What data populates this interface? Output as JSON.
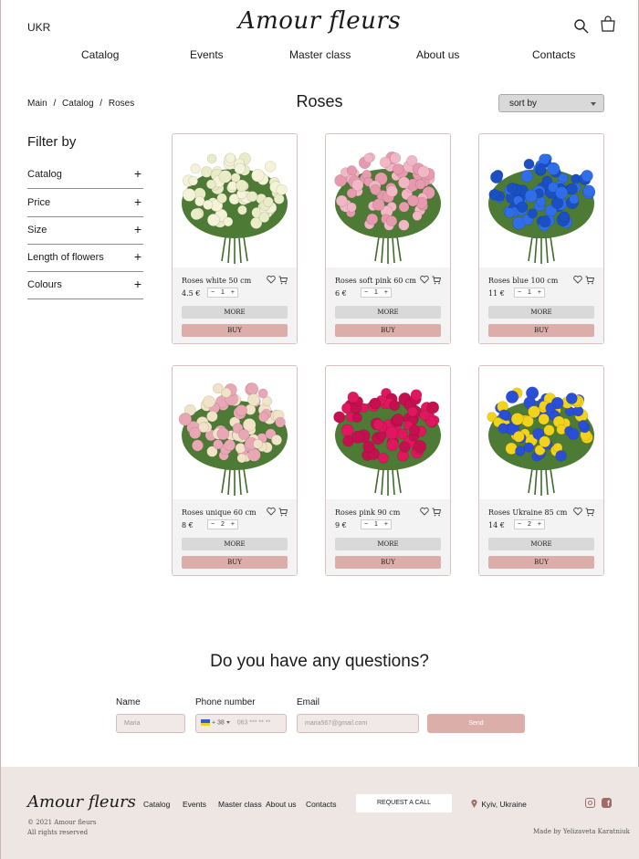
{
  "header": {
    "lang": "UKR",
    "logo": "Amour fleurs",
    "search_icon": "search-icon",
    "cart_icon": "shopping-bag-icon"
  },
  "nav": [
    "Catalog",
    "Events",
    "Master class",
    "About us",
    "Contacts"
  ],
  "breadcrumb": [
    "Main",
    "/",
    "Catalog",
    "/",
    "Roses"
  ],
  "page_title": "Roses",
  "sort": {
    "label": "sort by"
  },
  "filters": {
    "title": "Filter by",
    "items": [
      "Catalog",
      "Price",
      "Size",
      "Length of flowers",
      "Colours"
    ],
    "expand_symbol": "+"
  },
  "products": [
    {
      "name": "Roses white 50 cm",
      "price": "4.5 €",
      "qty": "1",
      "more": "MORE",
      "buy": "BUY",
      "colors": [
        "#f4f3d8",
        "#e9ecc7"
      ]
    },
    {
      "name": "Roses soft pink 60 cm",
      "price": "6 €",
      "qty": "1",
      "more": "MORE",
      "buy": "BUY",
      "colors": [
        "#f2b7c4",
        "#e79aae"
      ]
    },
    {
      "name": "Roses blue 100 cm",
      "price": "11 €",
      "qty": "1",
      "more": "MORE",
      "buy": "BUY",
      "colors": [
        "#2f6ee8",
        "#1b4fc4"
      ]
    },
    {
      "name": "Roses unique 60 cm",
      "price": "8 €",
      "qty": "2",
      "more": "MORE",
      "buy": "BUY",
      "colors": [
        "#f1e3c8",
        "#e9a7b5"
      ]
    },
    {
      "name": "Roses pink 90 cm",
      "price": "9 €",
      "qty": "1",
      "more": "MORE",
      "buy": "BUY",
      "colors": [
        "#e0165f",
        "#c4104f"
      ]
    },
    {
      "name": "Roses Ukraine 85 cm",
      "price": "14 €",
      "qty": "2",
      "more": "MORE",
      "buy": "BUY",
      "colors": [
        "#f3d21c",
        "#2a4fd6"
      ]
    }
  ],
  "qty_minus": "−",
  "qty_plus": "+",
  "questions": {
    "title": "Do you have any questions?",
    "name_label": "Name",
    "name_placeholder": "Maria",
    "phone_label": "Phone number",
    "phone_code": "+ 38",
    "phone_placeholder": "063 *** ** **",
    "email_label": "Email",
    "email_placeholder": "maria567@gmail.com",
    "send": "Send"
  },
  "footer": {
    "logo": "Amour fleurs",
    "nav": [
      "Catalog",
      "Events",
      "Master class",
      "About us",
      "Contacts"
    ],
    "request": "REQUEST A CALL",
    "location": "Kyiv, Ukraine",
    "copyright": "© 2021 Amour fleurs",
    "rights": "All rights reserved",
    "made_by": "Made by Yelizaveta Karatniuk"
  },
  "colors": {
    "accent": "#dbaea9",
    "footer_bg": "#ede6e3",
    "border": "#d8c2c0"
  }
}
